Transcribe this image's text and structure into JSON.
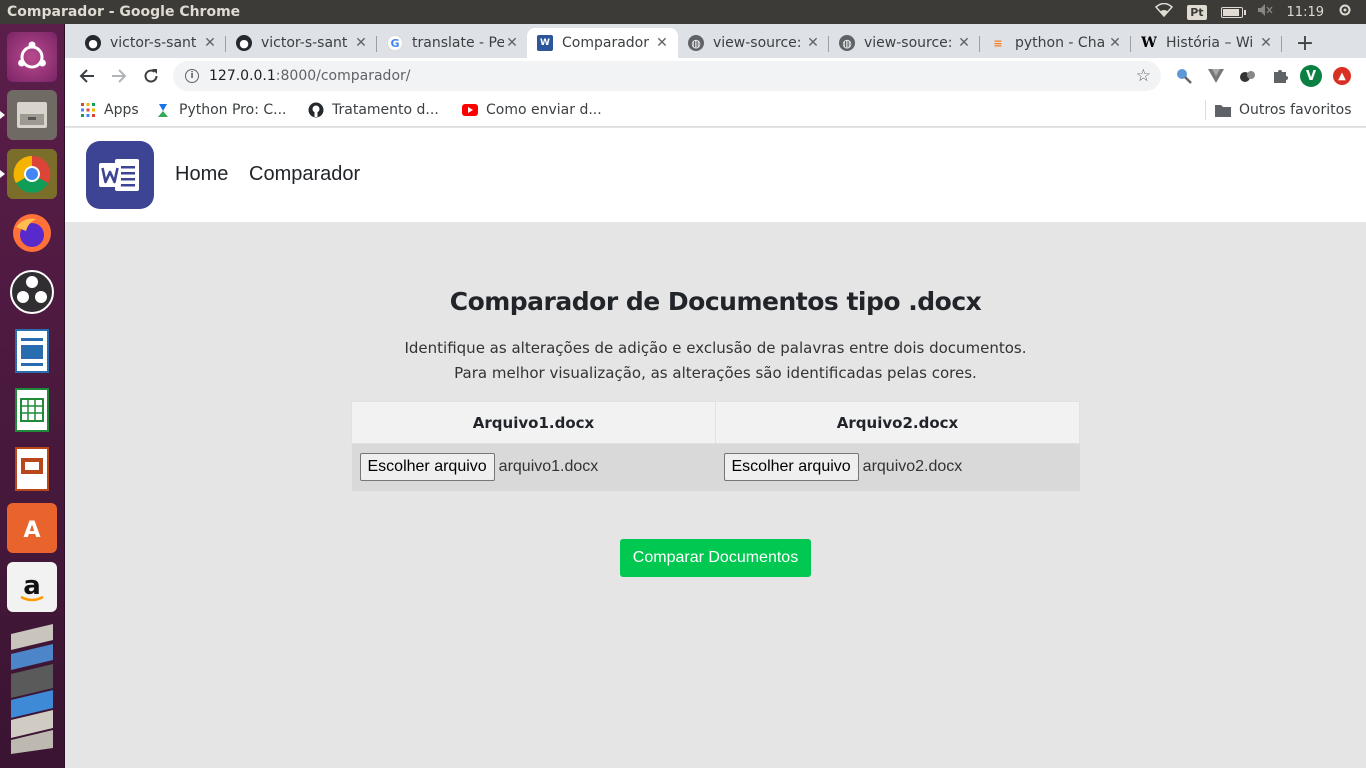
{
  "os": {
    "window_title": "Comparador - Google Chrome",
    "lang_indicator": "Pt",
    "clock": "11:19"
  },
  "tabs": [
    {
      "label": "victor-s-sant",
      "icon": "github-icon",
      "active": false
    },
    {
      "label": "victor-s-sant",
      "icon": "github-icon",
      "active": false
    },
    {
      "label": "translate - Pe",
      "icon": "google-icon",
      "active": false
    },
    {
      "label": "Comparador",
      "icon": "word-icon",
      "active": true
    },
    {
      "label": "view-source:",
      "icon": "globe-icon",
      "active": false
    },
    {
      "label": "view-source:",
      "icon": "globe-icon",
      "active": false
    },
    {
      "label": "python - Cha",
      "icon": "stackoverflow-icon",
      "active": false
    },
    {
      "label": "História – Wi",
      "icon": "wikipedia-icon",
      "active": false
    }
  ],
  "toolbar": {
    "url_host": "127.0.0.1",
    "url_rest": ":8000/comparador/",
    "profile_initial": "V"
  },
  "bookmarks": {
    "apps": "Apps",
    "items": [
      "Python Pro: C...",
      "Tratamento d...",
      "Como enviar d..."
    ],
    "other": "Outros favoritos"
  },
  "nav": {
    "home": "Home",
    "comparador": "Comparador"
  },
  "main": {
    "title": "Comparador de  Documentos tipo .docx",
    "desc_line1": "Identifique as alterações de adição e exclusão de palavras entre dois documentos.",
    "desc_line2": "Para melhor visualização, as alterações são identificadas pelas cores."
  },
  "files": {
    "col1_header": "Arquivo1.docx",
    "col2_header": "Arquivo2.docx",
    "choose_label": "Escolher arquivo",
    "file1_name": "arquivo1.docx",
    "file2_name": "arquivo2.docx"
  },
  "compare_button": "Comparar Documentos",
  "colors": {
    "compare_green": "#00c851",
    "logo_blue": "#3d4493",
    "launcher_purple": "#5b1e4a"
  }
}
